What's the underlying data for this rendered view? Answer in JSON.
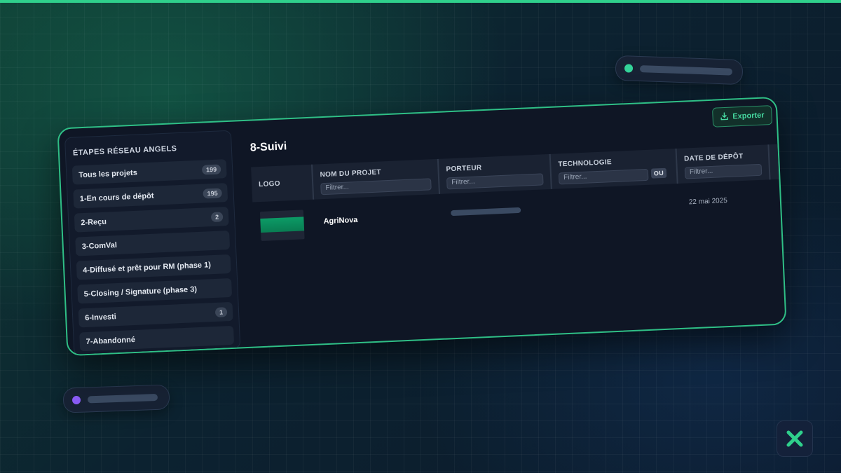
{
  "sidebar": {
    "title": "ÉTAPES RÉSEAU ANGELS",
    "items": [
      {
        "label": "Tous les projets",
        "count": "199"
      },
      {
        "label": "1-En cours de dépôt",
        "count": "195"
      },
      {
        "label": "2-Reçu",
        "count": "2"
      },
      {
        "label": "3-ComVal",
        "count": ""
      },
      {
        "label": "4-Diffusé et prêt pour RM (phase 1)",
        "count": ""
      },
      {
        "label": "5-Closing / Signature (phase 3)",
        "count": ""
      },
      {
        "label": "6-Investi",
        "count": "1"
      },
      {
        "label": "7-Abandonné",
        "count": ""
      }
    ]
  },
  "main": {
    "title": "8-Suivi",
    "export_label": "Exporter"
  },
  "table": {
    "columns": {
      "logo": "LOGO",
      "name": "NOM DU PROJET",
      "porteur": "PORTEUR",
      "technologie": "TECHNOLOGIE",
      "date": "DATE DE DÉPÔT"
    },
    "filter_placeholder": "Filtrer...",
    "ou_label": "OU",
    "rows": [
      {
        "name": "AgriNova",
        "date": "22 mai 2025"
      }
    ]
  },
  "colors": {
    "accent": "#2fbf86",
    "secondary_dot": "#8b5cf6"
  },
  "icons": {
    "export": "download-icon",
    "brand": "x-logo-icon"
  }
}
